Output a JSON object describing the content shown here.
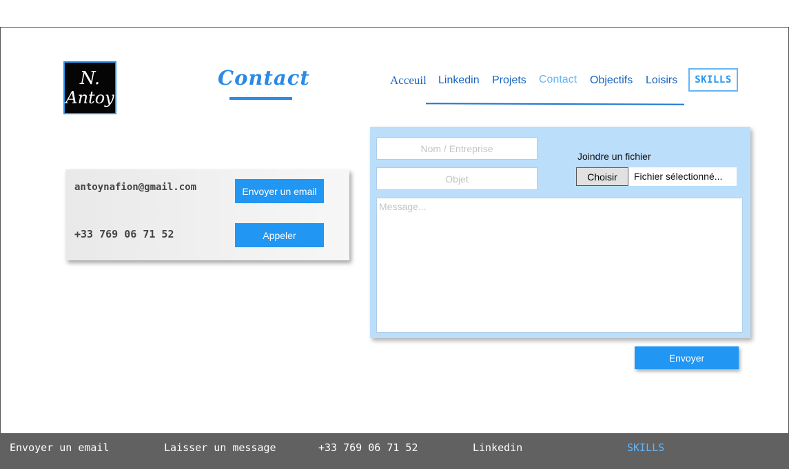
{
  "logo": {
    "line1": "N.",
    "line2": "Antoy"
  },
  "page_title": "Contact",
  "nav": {
    "items": [
      "Acceuil",
      "Linkedin",
      "Projets",
      "Contact",
      "Objectifs",
      "Loisirs"
    ],
    "skills": "SKILLS"
  },
  "contact_card": {
    "email": "antoynafion@gmail.com",
    "email_button": "Envoyer un email",
    "phone": "+33 769 06 71 52",
    "call_button": "Appeler"
  },
  "form": {
    "name_placeholder": "Nom / Entreprise",
    "subject_placeholder": "Objet",
    "attach_label": "Joindre un fichier",
    "choose_button": "Choisir",
    "file_selected": "Fichier sélectionné...",
    "message_placeholder": "Message...",
    "send_button": "Envoyer"
  },
  "footer": {
    "items": [
      "Envoyer un email",
      "Laisser un message",
      "+33 769 06 71 52",
      "Linkedin",
      "SKILLS"
    ]
  },
  "colors": {
    "accent": "#2196f3",
    "title": "#2a8ae6",
    "nav_link": "#1565c0",
    "nav_active": "#64b5f6",
    "form_bg": "#bbdefb",
    "footer_bg": "#616161"
  }
}
